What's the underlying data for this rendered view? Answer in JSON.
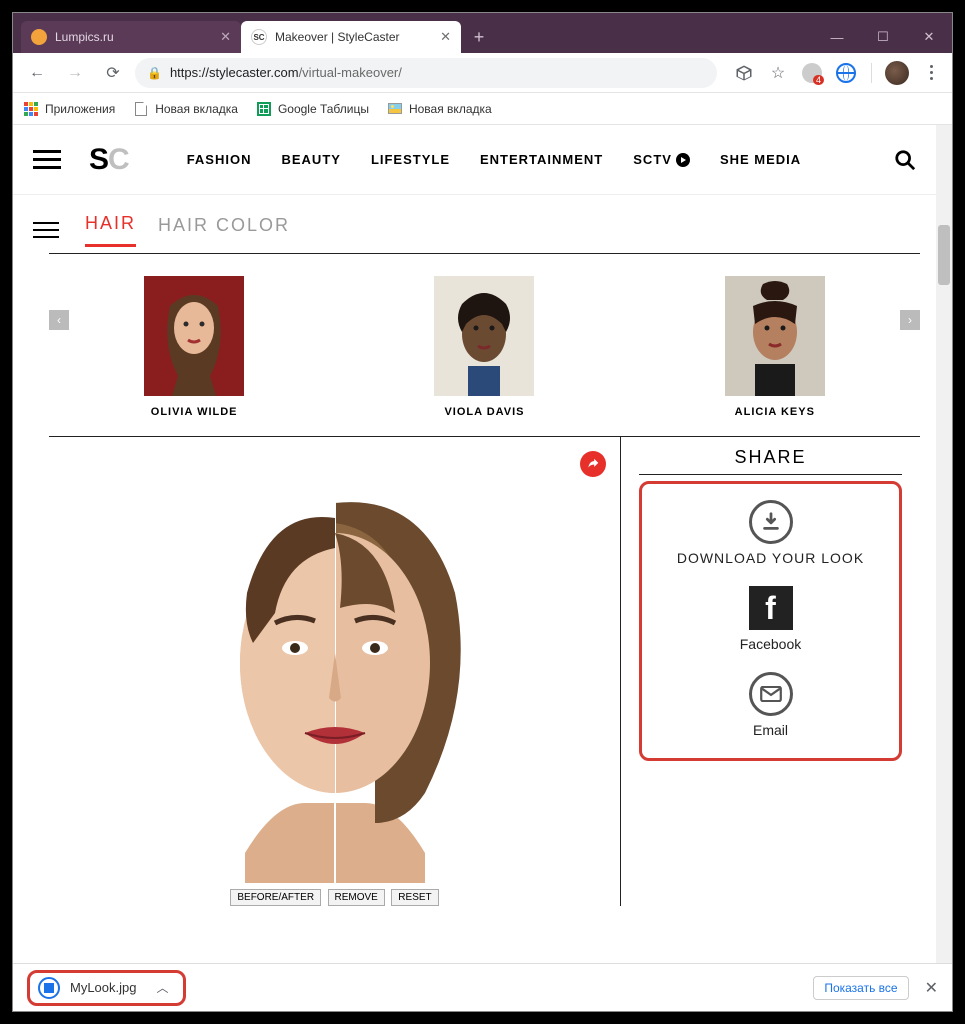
{
  "browser": {
    "tabs": [
      {
        "title": "Lumpics.ru",
        "active": false,
        "favicon_color": "#f3a33c"
      },
      {
        "title": "Makeover | StyleCaster",
        "active": true,
        "favicon_label": "SC"
      }
    ],
    "url_host": "https://stylecaster.com",
    "url_path": "/virtual-makeover/",
    "ext_badge": "4",
    "bookmarks": {
      "apps": "Приложения",
      "items": [
        "Новая вкладка",
        "Google Таблицы",
        "Новая вкладка"
      ]
    }
  },
  "site": {
    "nav": [
      "FASHION",
      "BEAUTY",
      "LIFESTYLE",
      "ENTERTAINMENT"
    ],
    "sctv": "SCTV",
    "shemedia": "SHE MEDIA"
  },
  "app": {
    "tabs": {
      "hair": "HAIR",
      "haircolor": "HAIR COLOR"
    },
    "celebs": [
      {
        "name": "OLIVIA WILDE"
      },
      {
        "name": "VIOLA DAVIS"
      },
      {
        "name": "ALICIA KEYS"
      }
    ],
    "tools": {
      "before_after": "BEFORE/AFTER",
      "remove": "REMOVE",
      "reset": "RESET"
    },
    "share": {
      "title": "SHARE",
      "download": "DOWNLOAD YOUR LOOK",
      "facebook": "Facebook",
      "email": "Email"
    }
  },
  "downloads": {
    "file": "MyLook.jpg",
    "show_all": "Показать все"
  }
}
